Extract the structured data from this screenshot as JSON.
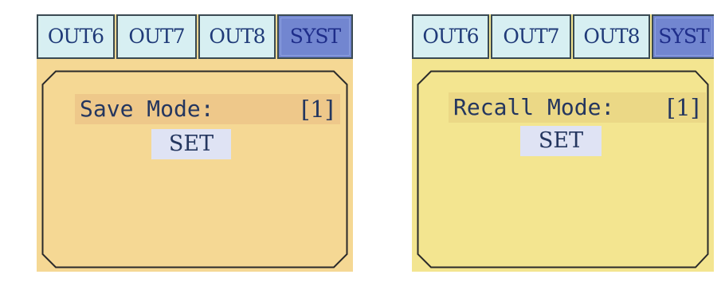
{
  "screens": [
    {
      "tabs": [
        {
          "label": "OUT6",
          "active": false
        },
        {
          "label": "OUT7",
          "active": false
        },
        {
          "label": "OUT8",
          "active": false
        },
        {
          "label": "SYST",
          "active": true
        }
      ],
      "mode_label": "Save Mode:",
      "mode_value": "[1]",
      "set_label": "SET"
    },
    {
      "tabs": [
        {
          "label": "OUT6",
          "active": false
        },
        {
          "label": "OUT7",
          "active": false
        },
        {
          "label": "OUT8",
          "active": false
        },
        {
          "label": "SYST",
          "active": true
        }
      ],
      "mode_label": "Recall Mode:",
      "mode_value": "[1]",
      "set_label": "SET"
    }
  ],
  "colors": {
    "left_background": "#f5d894",
    "right_background": "#f3e590",
    "tab_inactive": "#d7eff2",
    "tab_active": "#7286d0",
    "text": "#24365f"
  }
}
